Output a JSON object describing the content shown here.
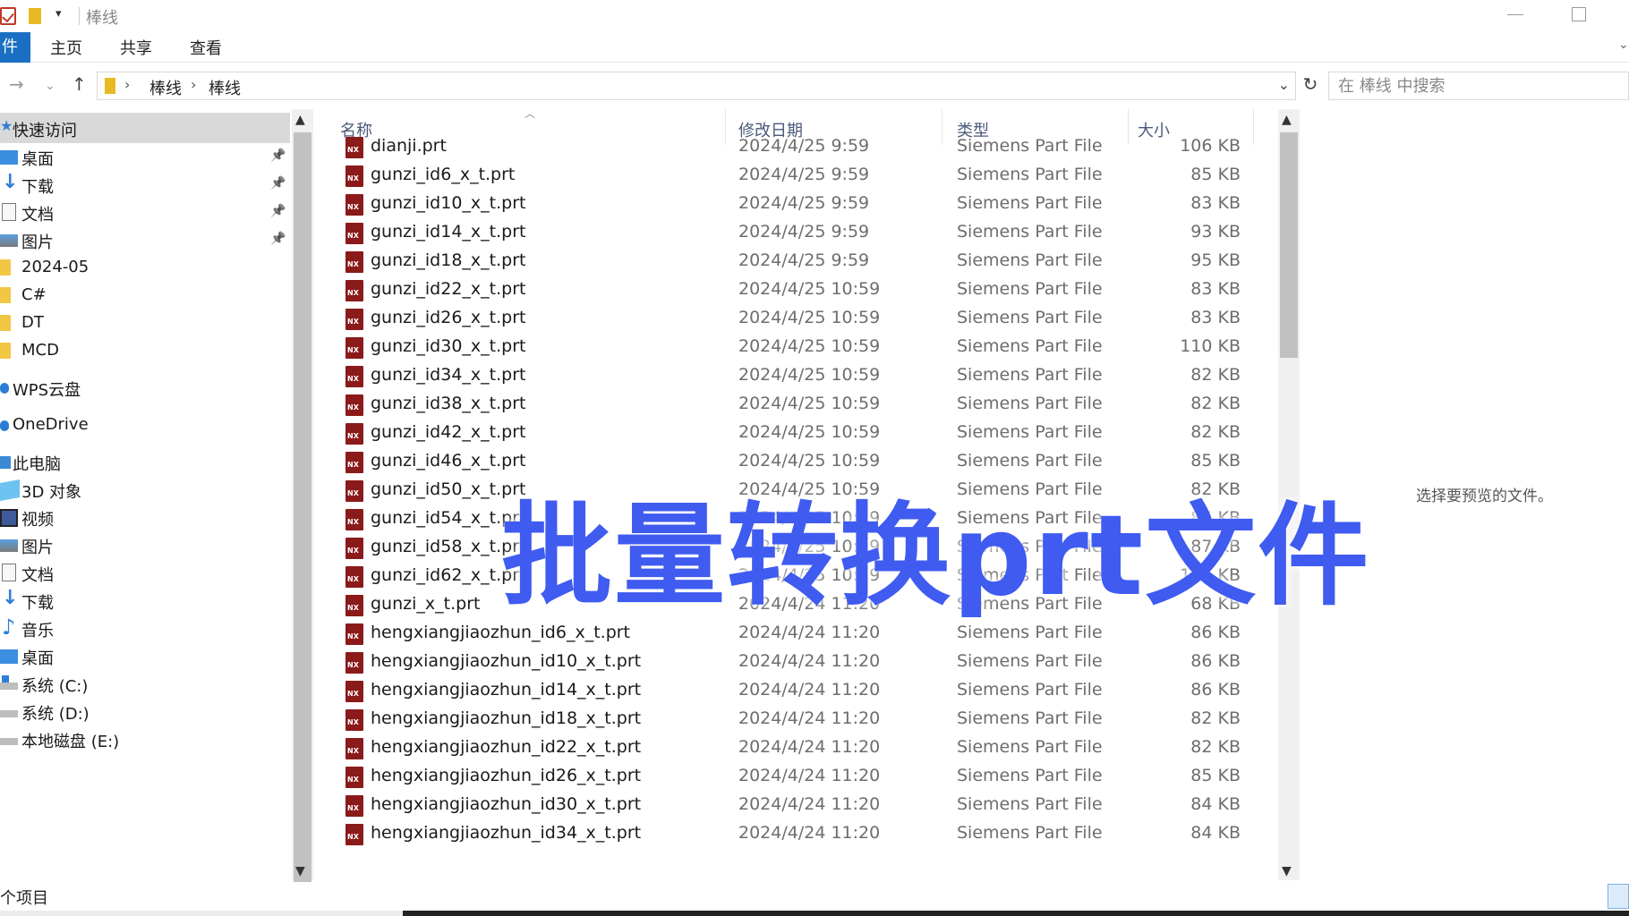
{
  "window": {
    "title": "棒线"
  },
  "ribbon": {
    "file_tab": "件",
    "tabs": [
      "主页",
      "共享",
      "查看"
    ]
  },
  "address": {
    "crumbs": [
      "棒线",
      "棒线"
    ],
    "search_placeholder": "在 棒线 中搜索"
  },
  "sidebar": {
    "items": [
      {
        "label": "快速访问",
        "icon": "star-icon",
        "pinned": false,
        "selected": true
      },
      {
        "label": "桌面",
        "icon": "desktop-icon",
        "pinned": true
      },
      {
        "label": "下载",
        "icon": "download-icon",
        "pinned": true
      },
      {
        "label": "文档",
        "icon": "document-icon",
        "pinned": true
      },
      {
        "label": "图片",
        "icon": "pictures-icon",
        "pinned": true
      },
      {
        "label": "2024-05",
        "icon": "folder-icon",
        "pinned": false
      },
      {
        "label": "C#",
        "icon": "folder-icon",
        "pinned": false
      },
      {
        "label": "DT",
        "icon": "folder-icon",
        "pinned": false
      },
      {
        "label": "MCD",
        "icon": "folder-icon",
        "pinned": false
      },
      {
        "label": "WPS云盘",
        "icon": "cloud-icon",
        "pinned": false
      },
      {
        "label": "OneDrive",
        "icon": "cloud-icon",
        "pinned": false
      },
      {
        "label": "此电脑",
        "icon": "computer-icon",
        "pinned": false
      },
      {
        "label": "3D 对象",
        "icon": "3d-objects-icon",
        "pinned": false
      },
      {
        "label": "视频",
        "icon": "video-icon",
        "pinned": false
      },
      {
        "label": "图片",
        "icon": "pictures-icon",
        "pinned": false
      },
      {
        "label": "文档",
        "icon": "document-icon",
        "pinned": false
      },
      {
        "label": "下载",
        "icon": "download-icon",
        "pinned": false
      },
      {
        "label": "音乐",
        "icon": "music-icon",
        "pinned": false
      },
      {
        "label": "桌面",
        "icon": "desktop-icon",
        "pinned": false
      },
      {
        "label": "系统 (C:)",
        "icon": "drive-icon",
        "pinned": false
      },
      {
        "label": "系统 (D:)",
        "icon": "drive-icon",
        "pinned": false
      },
      {
        "label": "本地磁盘 (E:)",
        "icon": "drive-icon",
        "pinned": false
      }
    ]
  },
  "columns": {
    "name": "名称",
    "date": "修改日期",
    "type": "类型",
    "size": "大小"
  },
  "files": [
    {
      "name": "dianji.prt",
      "date": "2024/4/25 9:59",
      "type": "Siemens Part File",
      "size": "106 KB"
    },
    {
      "name": "gunzi_id6_x_t.prt",
      "date": "2024/4/25 9:59",
      "type": "Siemens Part File",
      "size": "85 KB"
    },
    {
      "name": "gunzi_id10_x_t.prt",
      "date": "2024/4/25 9:59",
      "type": "Siemens Part File",
      "size": "83 KB"
    },
    {
      "name": "gunzi_id14_x_t.prt",
      "date": "2024/4/25 9:59",
      "type": "Siemens Part File",
      "size": "93 KB"
    },
    {
      "name": "gunzi_id18_x_t.prt",
      "date": "2024/4/25 9:59",
      "type": "Siemens Part File",
      "size": "95 KB"
    },
    {
      "name": "gunzi_id22_x_t.prt",
      "date": "2024/4/25 10:59",
      "type": "Siemens Part File",
      "size": "83 KB"
    },
    {
      "name": "gunzi_id26_x_t.prt",
      "date": "2024/4/25 10:59",
      "type": "Siemens Part File",
      "size": "83 KB"
    },
    {
      "name": "gunzi_id30_x_t.prt",
      "date": "2024/4/25 10:59",
      "type": "Siemens Part File",
      "size": "110 KB"
    },
    {
      "name": "gunzi_id34_x_t.prt",
      "date": "2024/4/25 10:59",
      "type": "Siemens Part File",
      "size": "82 KB"
    },
    {
      "name": "gunzi_id38_x_t.prt",
      "date": "2024/4/25 10:59",
      "type": "Siemens Part File",
      "size": "82 KB"
    },
    {
      "name": "gunzi_id42_x_t.prt",
      "date": "2024/4/25 10:59",
      "type": "Siemens Part File",
      "size": "82 KB"
    },
    {
      "name": "gunzi_id46_x_t.prt",
      "date": "2024/4/25 10:59",
      "type": "Siemens Part File",
      "size": "85 KB"
    },
    {
      "name": "gunzi_id50_x_t.prt",
      "date": "2024/4/25 10:59",
      "type": "Siemens Part File",
      "size": "82 KB"
    },
    {
      "name": "gunzi_id54_x_t.prt",
      "date": "2024/4/25 10:59",
      "type": "Siemens Part File",
      "size": "85 KB"
    },
    {
      "name": "gunzi_id58_x_t.prt",
      "date": "2024/4/25 10:59",
      "type": "Siemens Part File",
      "size": "87 KB"
    },
    {
      "name": "gunzi_id62_x_t.prt",
      "date": "2024/4/25 10:59",
      "type": "Siemens Part File",
      "size": "117 KB"
    },
    {
      "name": "gunzi_x_t.prt",
      "date": "2024/4/24 11:20",
      "type": "Siemens Part File",
      "size": "68 KB"
    },
    {
      "name": "hengxiangjiaozhun_id6_x_t.prt",
      "date": "2024/4/24 11:20",
      "type": "Siemens Part File",
      "size": "86 KB"
    },
    {
      "name": "hengxiangjiaozhun_id10_x_t.prt",
      "date": "2024/4/24 11:20",
      "type": "Siemens Part File",
      "size": "86 KB"
    },
    {
      "name": "hengxiangjiaozhun_id14_x_t.prt",
      "date": "2024/4/24 11:20",
      "type": "Siemens Part File",
      "size": "86 KB"
    },
    {
      "name": "hengxiangjiaozhun_id18_x_t.prt",
      "date": "2024/4/24 11:20",
      "type": "Siemens Part File",
      "size": "82 KB"
    },
    {
      "name": "hengxiangjiaozhun_id22_x_t.prt",
      "date": "2024/4/24 11:20",
      "type": "Siemens Part File",
      "size": "82 KB"
    },
    {
      "name": "hengxiangjiaozhun_id26_x_t.prt",
      "date": "2024/4/24 11:20",
      "type": "Siemens Part File",
      "size": "85 KB"
    },
    {
      "name": "hengxiangjiaozhun_id30_x_t.prt",
      "date": "2024/4/24 11:20",
      "type": "Siemens Part File",
      "size": "84 KB"
    },
    {
      "name": "hengxiangjiaozhun_id34_x_t.prt",
      "date": "2024/4/24 11:20",
      "type": "Siemens Part File",
      "size": "84 KB"
    }
  ],
  "file_icon_text": "NX",
  "preview": {
    "text": "选择要预览的文件。"
  },
  "status": {
    "text": "个项目"
  },
  "overlay": {
    "text": "批量转换prt文件",
    "color": "#3f5bf0"
  },
  "colors": {
    "accent": "#1a6fc4",
    "file_icon": "#8b1a1a",
    "folder": "#e8b923"
  }
}
